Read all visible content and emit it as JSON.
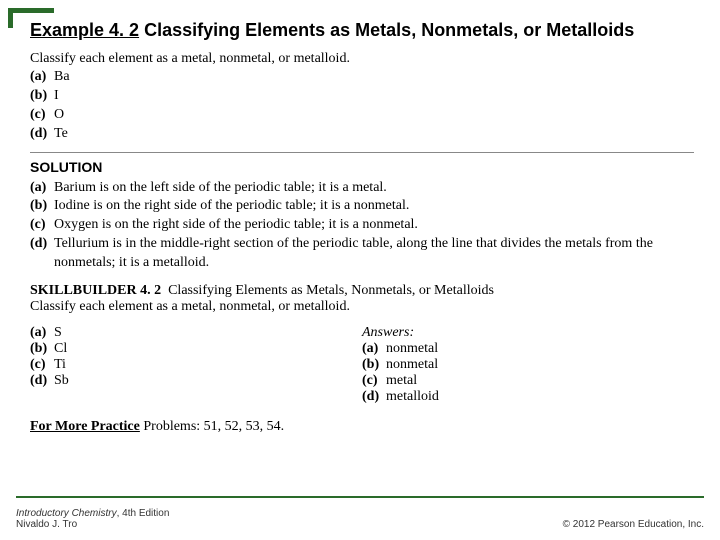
{
  "header": {
    "example_label": "Example 4. 2",
    "title_rest": " Classifying Elements as Metals, Nonmetals, or Metalloids"
  },
  "problem": {
    "prompt": "Classify each element as a metal, nonmetal, or metalloid.",
    "items": [
      {
        "label": "(a)",
        "text": "Ba"
      },
      {
        "label": "(b)",
        "text": "I"
      },
      {
        "label": "(c)",
        "text": "O"
      },
      {
        "label": "(d)",
        "text": "Te"
      }
    ]
  },
  "solution": {
    "heading": "SOLUTION",
    "items": [
      {
        "label": "(a)",
        "text": "Barium is on the left side of the periodic table; it is a metal."
      },
      {
        "label": "(b)",
        "text": "Iodine is on the right side of the periodic table; it is a nonmetal."
      },
      {
        "label": "(c)",
        "text": "Oxygen is on the right side of the periodic table; it is a nonmetal."
      },
      {
        "label": "(d)",
        "text": "Tellurium is in the middle-right section of the periodic table, along the line that divides the metals from the nonmetals; it is a metalloid."
      }
    ]
  },
  "skillbuilder": {
    "title": "SKILLBUILDER 4. 2",
    "subtitle": "Classifying Elements as Metals, Nonmetals, or Metalloids",
    "prompt": "Classify each element as a metal, nonmetal, or metalloid.",
    "items": [
      {
        "label": "(a)",
        "text": "S"
      },
      {
        "label": "(b)",
        "text": "Cl"
      },
      {
        "label": "(c)",
        "text": "Ti"
      },
      {
        "label": "(d)",
        "text": "Sb"
      }
    ],
    "answers_heading": "Answers:",
    "answers": [
      {
        "label": "(a)",
        "text": "nonmetal"
      },
      {
        "label": "(b)",
        "text": "nonmetal"
      },
      {
        "label": "(c)",
        "text": "metal"
      },
      {
        "label": "(d)",
        "text": "metalloid"
      }
    ]
  },
  "more_practice": {
    "label": "For More Practice",
    "text": " Problems: 51, 52, 53, 54."
  },
  "footer": {
    "book_title": "Introductory Chemistry",
    "edition": ", 4th Edition",
    "author": "Nivaldo J. Tro",
    "copyright": "© 2012 Pearson Education, Inc."
  }
}
